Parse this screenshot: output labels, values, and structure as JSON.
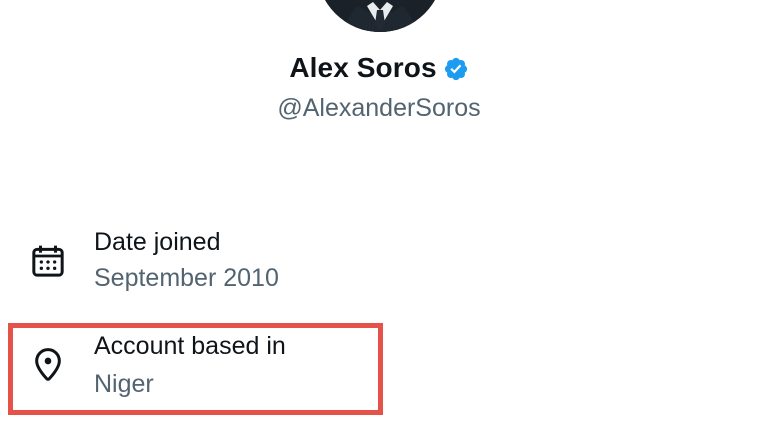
{
  "profile": {
    "name": "Alex Soros",
    "handle": "@AlexanderSoros",
    "verified": true,
    "avatar_icon": "profile-photo"
  },
  "about": {
    "date_joined": {
      "title": "Date joined",
      "value": "September 2010",
      "icon": "calendar-icon"
    },
    "account_based_in": {
      "title": "Account based in",
      "value": "Niger",
      "icon": "location-pin-icon"
    }
  },
  "colors": {
    "text_primary": "#0f1419",
    "text_secondary": "#536471",
    "verified_blue": "#1d9bf0",
    "highlight_red": "#e5524a"
  }
}
